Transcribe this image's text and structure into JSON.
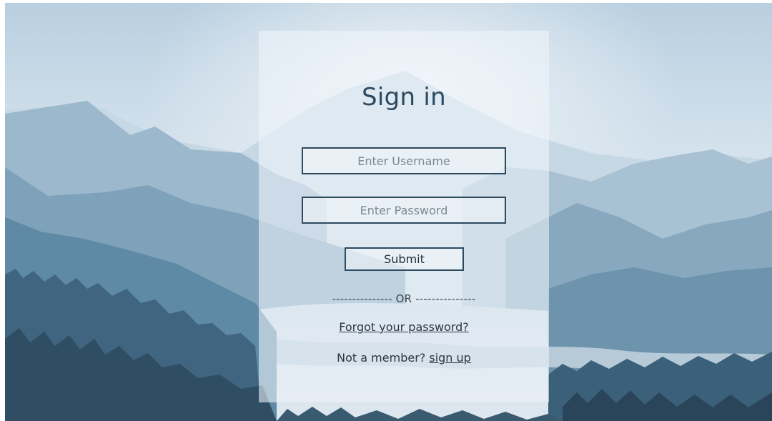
{
  "page": {
    "title": "Sign in"
  },
  "form": {
    "username_placeholder": "Enter Username",
    "password_placeholder": "Enter Password",
    "username_value": "",
    "password_value": "",
    "submit_label": "Submit",
    "divider_text": "--------------- OR ---------------",
    "forgot_link": "Forgot your password?",
    "signup_prompt": "Not a member? ",
    "signup_link": "sign up"
  },
  "colors": {
    "title": "#2c4a61",
    "border": "#2e4a5f",
    "sky": "#c8d9e6",
    "mountain_far": "#a9c3d5",
    "mountain_mid": "#7ea3bc",
    "mountain_near": "#5b84a0",
    "forest": "#3a5c73"
  },
  "icons": {
    "background": "mountain-landscape-illustration"
  }
}
